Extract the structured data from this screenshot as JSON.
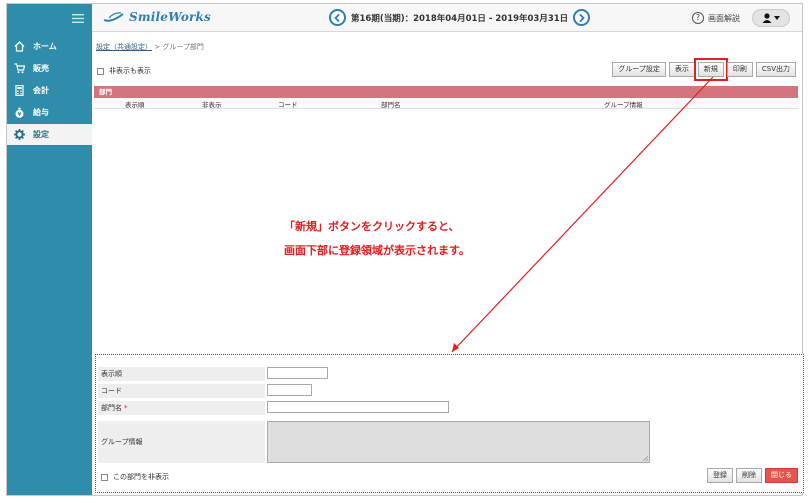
{
  "header": {
    "logo_text": "SmileWorks",
    "period_text": "第16期(当期)：2018年04月01日 - 2019年03月31日",
    "help_label": "画面解説",
    "help_symbol": "?"
  },
  "sidebar": {
    "items": [
      {
        "label": "ホーム",
        "icon": "home-icon"
      },
      {
        "label": "販売",
        "icon": "cart-icon"
      },
      {
        "label": "会計",
        "icon": "calculator-icon"
      },
      {
        "label": "給与",
        "icon": "money-bag-icon"
      },
      {
        "label": "設定",
        "icon": "gear-icon"
      }
    ],
    "active": "設定"
  },
  "breadcrumb": {
    "link": "設定（共通設定）",
    "separator": ">",
    "current": "グループ部門"
  },
  "filters": {
    "show_hidden_label": "非表示も表示",
    "show_hidden_checked": false
  },
  "toolbar": {
    "group_settings": "グループ設定",
    "show": "表示",
    "new": "新規",
    "print": "印刷",
    "csv": "CSV出力"
  },
  "table": {
    "section_title": "部門",
    "columns": [
      "表示順",
      "非表示",
      "コード",
      "部門名",
      "グループ情報"
    ],
    "rows": []
  },
  "annotation": {
    "line1": "「新規」ボタンをクリックすると、",
    "line2": "画面下部に登録領域が表示されます。"
  },
  "form": {
    "order_label": "表示順",
    "code_label": "コード",
    "name_label": "部門名",
    "required_mark": "*",
    "group_label": "グループ情報",
    "order_value": "",
    "code_value": "",
    "name_value": "",
    "hide_label": "この部門を非表示",
    "hide_checked": false,
    "register": "登録",
    "delete": "削除",
    "close": "閉じる"
  },
  "colors": {
    "sidebar": "#2e8dab",
    "section_bar": "#d4747f",
    "annotation": "#e01f1f",
    "logo": "#2d7fb5"
  }
}
